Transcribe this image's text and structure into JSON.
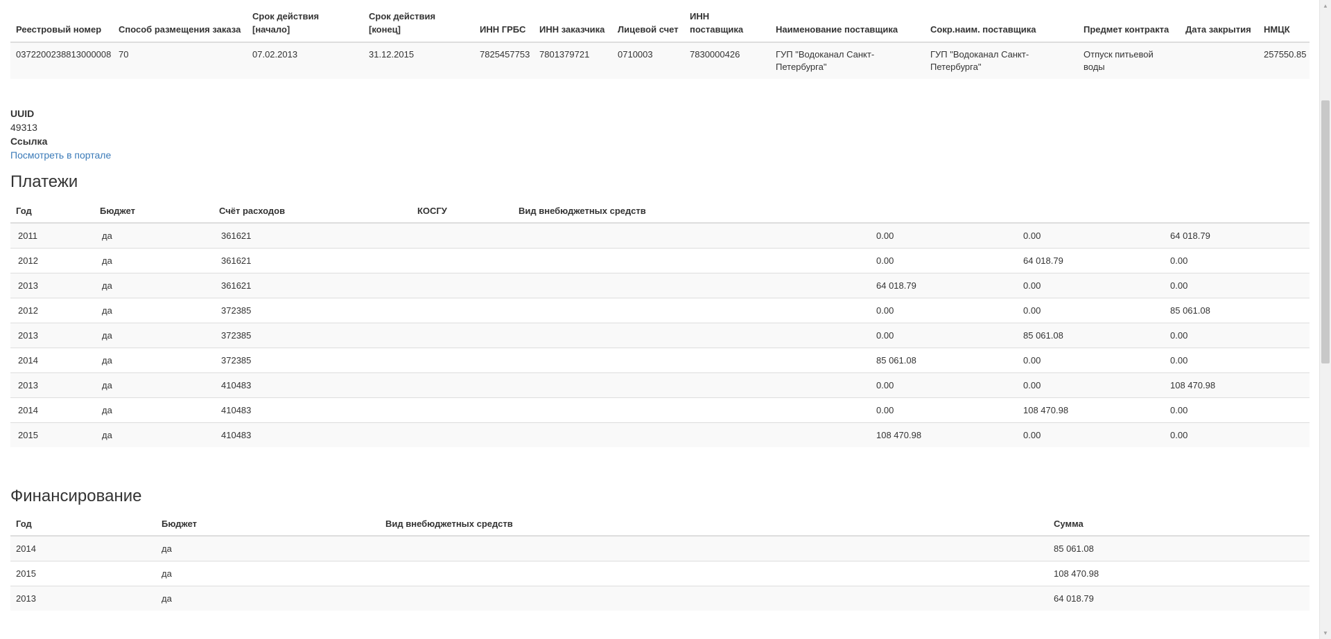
{
  "contract": {
    "headers": [
      "Реестровый номер",
      "Способ размещения заказа",
      "Срок действия [начало]",
      "Срок действия [конец]",
      "ИНН ГРБС",
      "ИНН заказчика",
      "Лицевой счет",
      "ИНН поставщика",
      "Наименование поставщика",
      "Сокр.наим. поставщика",
      "Предмет контракта",
      "Дата закрытия",
      "НМЦК"
    ],
    "row": [
      "0372200238813000008",
      "70",
      "07.02.2013",
      "31.12.2015",
      "7825457753",
      "7801379721",
      "0710003",
      "7830000426",
      "ГУП \"Водоканал Санкт-Петербурга\"",
      "ГУП \"Водоканал Санкт-Петербурга\"",
      "Отпуск питьевой воды",
      "",
      "257550.85"
    ]
  },
  "info": {
    "uuid_label": "UUID",
    "uuid_value": "49313",
    "link_label": "Ссылка",
    "link_text": "Посмотреть в портале"
  },
  "payments": {
    "title": "Платежи",
    "headers": [
      "Год",
      "Бюджет",
      "Счёт расходов",
      "КОСГУ",
      "Вид внебюджетных средств",
      "",
      "",
      ""
    ],
    "rows": [
      [
        "2011",
        "да",
        "361621",
        "",
        "",
        "0.00",
        "0.00",
        "64 018.79"
      ],
      [
        "2012",
        "да",
        "361621",
        "",
        "",
        "0.00",
        "64 018.79",
        "0.00"
      ],
      [
        "2013",
        "да",
        "361621",
        "",
        "",
        "64 018.79",
        "0.00",
        "0.00"
      ],
      [
        "2012",
        "да",
        "372385",
        "",
        "",
        "0.00",
        "0.00",
        "85 061.08"
      ],
      [
        "2013",
        "да",
        "372385",
        "",
        "",
        "0.00",
        "85 061.08",
        "0.00"
      ],
      [
        "2014",
        "да",
        "372385",
        "",
        "",
        "85 061.08",
        "0.00",
        "0.00"
      ],
      [
        "2013",
        "да",
        "410483",
        "",
        "",
        "0.00",
        "0.00",
        "108 470.98"
      ],
      [
        "2014",
        "да",
        "410483",
        "",
        "",
        "0.00",
        "108 470.98",
        "0.00"
      ],
      [
        "2015",
        "да",
        "410483",
        "",
        "",
        "108 470.98",
        "0.00",
        "0.00"
      ]
    ]
  },
  "funding": {
    "title": "Финансирование",
    "headers": [
      "Год",
      "Бюджет",
      "Вид внебюджетных средств",
      "Сумма"
    ],
    "rows": [
      [
        "2014",
        "да",
        "",
        "85 061.08"
      ],
      [
        "2015",
        "да",
        "",
        "108 470.98"
      ],
      [
        "2013",
        "да",
        "",
        "64 018.79"
      ]
    ]
  },
  "icons": {
    "scroll_up": "chevron-up-icon",
    "scroll_down": "chevron-down-icon"
  }
}
